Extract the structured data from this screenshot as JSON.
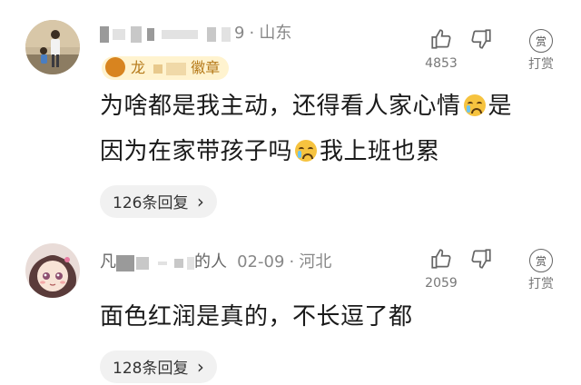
{
  "comments": [
    {
      "username_suffix": "9",
      "location": "山东",
      "badge": {
        "prefix": "龙",
        "suffix": "徽章"
      },
      "text_line1": "为啥都是我主动，还得看人家心情",
      "text_line1_tail": "是",
      "text_line2": "因为在家带孩子吗",
      "text_line2_tail": "我上班也累",
      "like_count": "4853",
      "reward_icon_text": "赏",
      "reward_label": "打赏",
      "reply_label": "126条回复",
      "reply_chevron": "›"
    },
    {
      "username_first": "凡",
      "username_suffix": "的人",
      "date": "02-09",
      "dot": "·",
      "location": "河北",
      "text_line1": "面色红润是真的，不长逗了都",
      "like_count": "2059",
      "reward_icon_text": "赏",
      "reward_label": "打赏",
      "reply_label": "128条回复",
      "reply_chevron": "›"
    }
  ],
  "icons": [
    "thumbs-up-icon",
    "thumbs-down-icon",
    "reward-icon",
    "crying-emoji-icon",
    "chevron-right-icon"
  ]
}
